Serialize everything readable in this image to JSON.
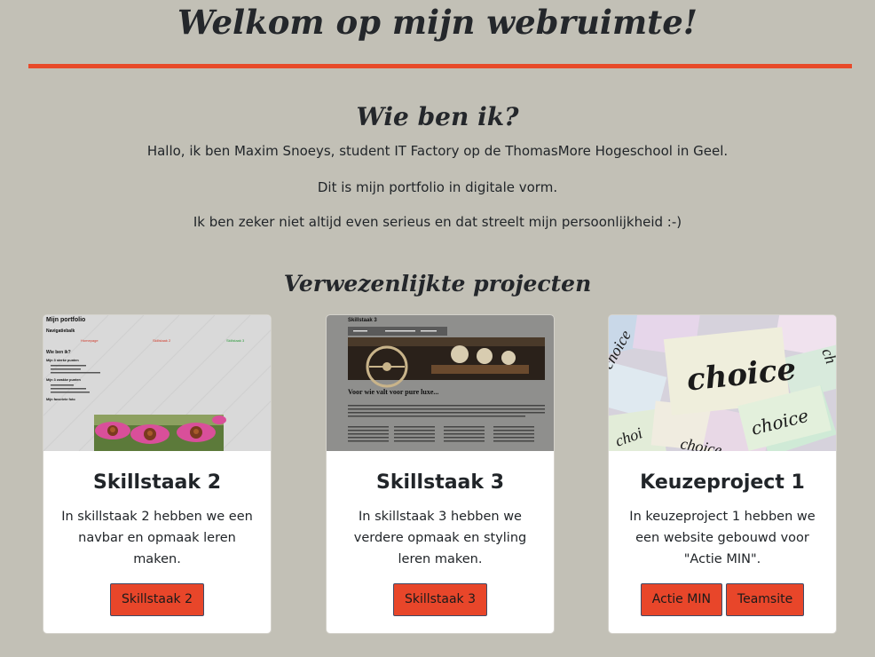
{
  "header": {
    "title": "Welkom op mijn webruimte!"
  },
  "about": {
    "heading": "Wie ben ik?",
    "lines": [
      "Hallo, ik ben Maxim Snoeys, student IT Factory op de ThomasMore Hogeschool in Geel.",
      "Dit is mijn portfolio in digitale vorm.",
      "Ik ben zeker niet altijd even serieus en dat streelt mijn persoonlijkheid :-)"
    ]
  },
  "projects": {
    "heading": "Verwezenlijkte projecten",
    "cards": [
      {
        "title": "Skillstaak 2",
        "text": "In skillstaak 2 hebben we een navbar en opmaak leren maken.",
        "buttons": [
          "Skillstaak 2"
        ],
        "thumbnail": {
          "page_title": "Mijn portfolio",
          "nav_label": "Navigatiebalk",
          "nav_links": [
            "Homepage",
            "Skillstaak 2",
            "Skillstaak 3"
          ],
          "section_1": "Wie ben ik?",
          "section_2": "Mijn 3 sterke punten",
          "section_3": "Mijn 3 zwakke punten",
          "section_4": "Mijn favoriete foto"
        }
      },
      {
        "title": "Skillstaak 3",
        "text": "In skillstaak 3 hebben we verdere opmaak en styling leren maken.",
        "buttons": [
          "Skillstaak 3"
        ],
        "thumbnail": {
          "page_title": "Skillstaak 3",
          "heading": "Voor wie valt voor pure luxe..."
        }
      },
      {
        "title": "Keuzeproject 1",
        "text": "In keuzeproject 1 hebben we een website gebouwd voor \"Actie MIN\".",
        "buttons": [
          "Actie MIN",
          "Teamsite"
        ],
        "thumbnail": {
          "word": "choice"
        }
      }
    ]
  },
  "colors": {
    "background": "#c2c0b6",
    "accent": "#e84a2a",
    "button": "#e8462a",
    "card": "#ffffff"
  }
}
